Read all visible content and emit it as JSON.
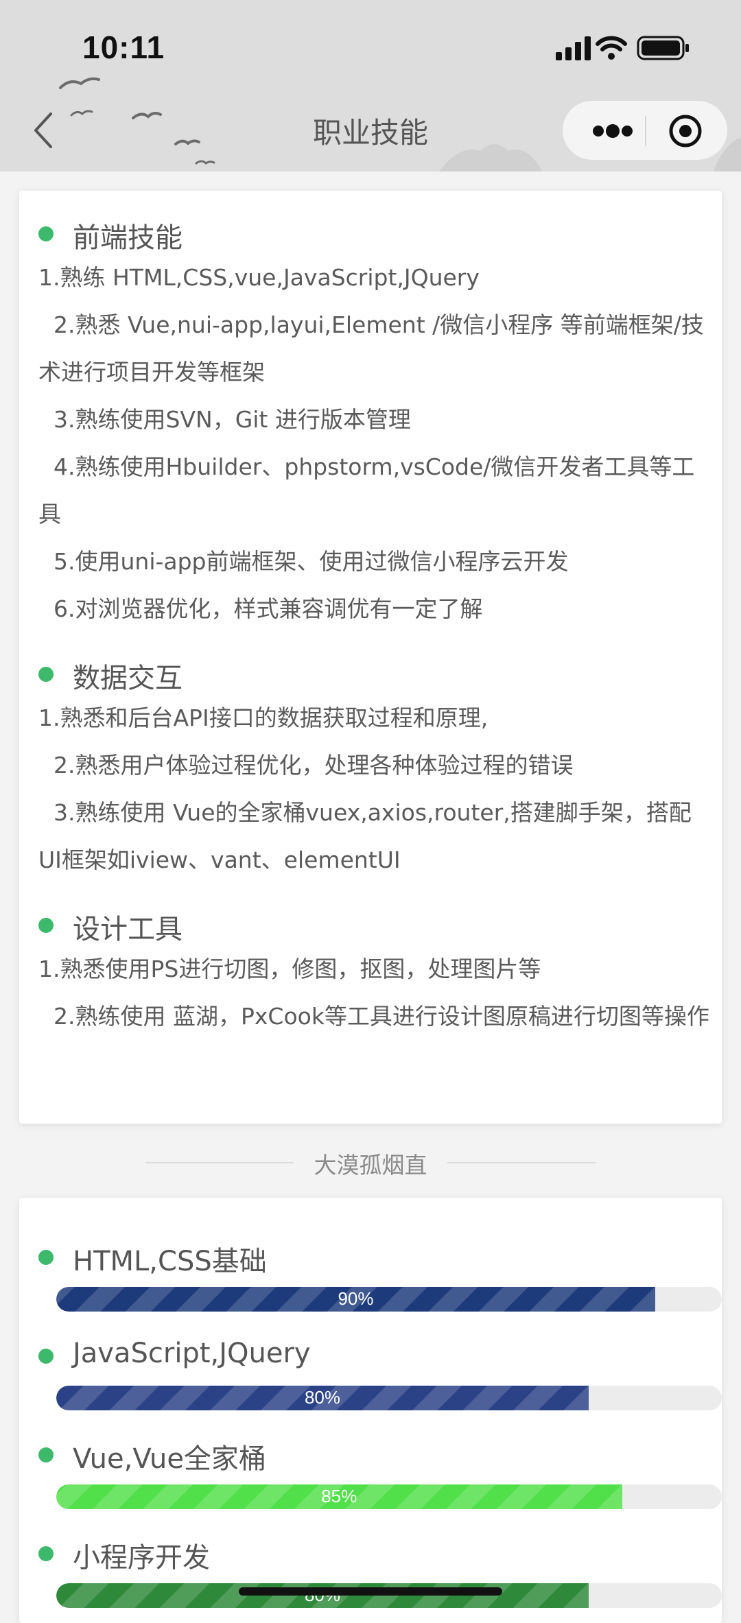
{
  "status_bar": {
    "time": "10:11"
  },
  "nav": {
    "title": "职业技能"
  },
  "sections": [
    {
      "title": "前端技能",
      "lines": [
        "1.熟练 HTML,CSS,vue,JavaScript,JQuery",
        "2.熟悉 Vue,nui-app,layui,Element /微信小程序 等前端框架/技术进行项目开发等框架",
        "3.熟练使用SVN，Git 进行版本管理",
        "4.熟练使用Hbuilder、phpstorm,vsCode/微信开发者工具等工具",
        "5.使用uni-app前端框架、使用过微信小程序云开发",
        "6.对浏览器优化，样式兼容调优有一定了解"
      ]
    },
    {
      "title": "数据交互",
      "lines": [
        "1.熟悉和后台API接口的数据获取过程和原理,",
        "2.熟悉用户体验过程优化，处理各种体验过程的错误",
        "3.熟练使用 Vue的全家桶vuex,axios,router,搭建脚手架，搭配UI框架如iview、vant、elementUI"
      ]
    },
    {
      "title": "设计工具",
      "lines": [
        "1.熟悉使用PS进行切图，修图，抠图，处理图片等",
        "2.熟练使用 蓝湖，PxCook等工具进行设计图原稿进行切图等操作"
      ]
    }
  ],
  "divider": {
    "text": "大漠孤烟直"
  },
  "skills": [
    {
      "name": "HTML,CSS基础",
      "percent": 90,
      "label": "90%",
      "color": "#1d3a7a"
    },
    {
      "name": "JavaScript,JQuery",
      "percent": 80,
      "label": "80%",
      "color": "#2b4287"
    },
    {
      "name": "Vue,Vue全家桶",
      "percent": 85,
      "label": "85%",
      "color": "#52e04a"
    },
    {
      "name": "小程序开发",
      "percent": 80,
      "label": "80%",
      "color": "#2e8a3a"
    }
  ],
  "colors": {
    "accent_dot": "#3cb96a",
    "card_bg": "#ffffff",
    "page_bg": "#f3f3f3"
  }
}
